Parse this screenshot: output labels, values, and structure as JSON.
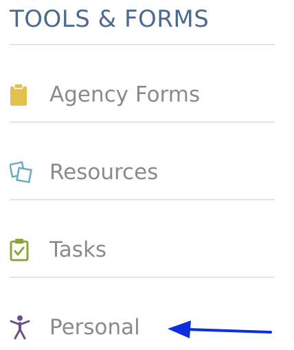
{
  "section": {
    "title": "TOOLS & FORMS"
  },
  "menu": {
    "items": [
      {
        "label": "Agency Forms",
        "icon": "clipboard-icon",
        "color": "#e2c14e"
      },
      {
        "label": "Resources",
        "icon": "resources-icon",
        "color": "#6aaac8"
      },
      {
        "label": "Tasks",
        "icon": "task-check-icon",
        "color": "#8aa63a"
      },
      {
        "label": "Personal",
        "icon": "person-icon",
        "color": "#6a4f8a"
      }
    ]
  },
  "annotation": {
    "arrow_color": "#0a2ee0"
  }
}
